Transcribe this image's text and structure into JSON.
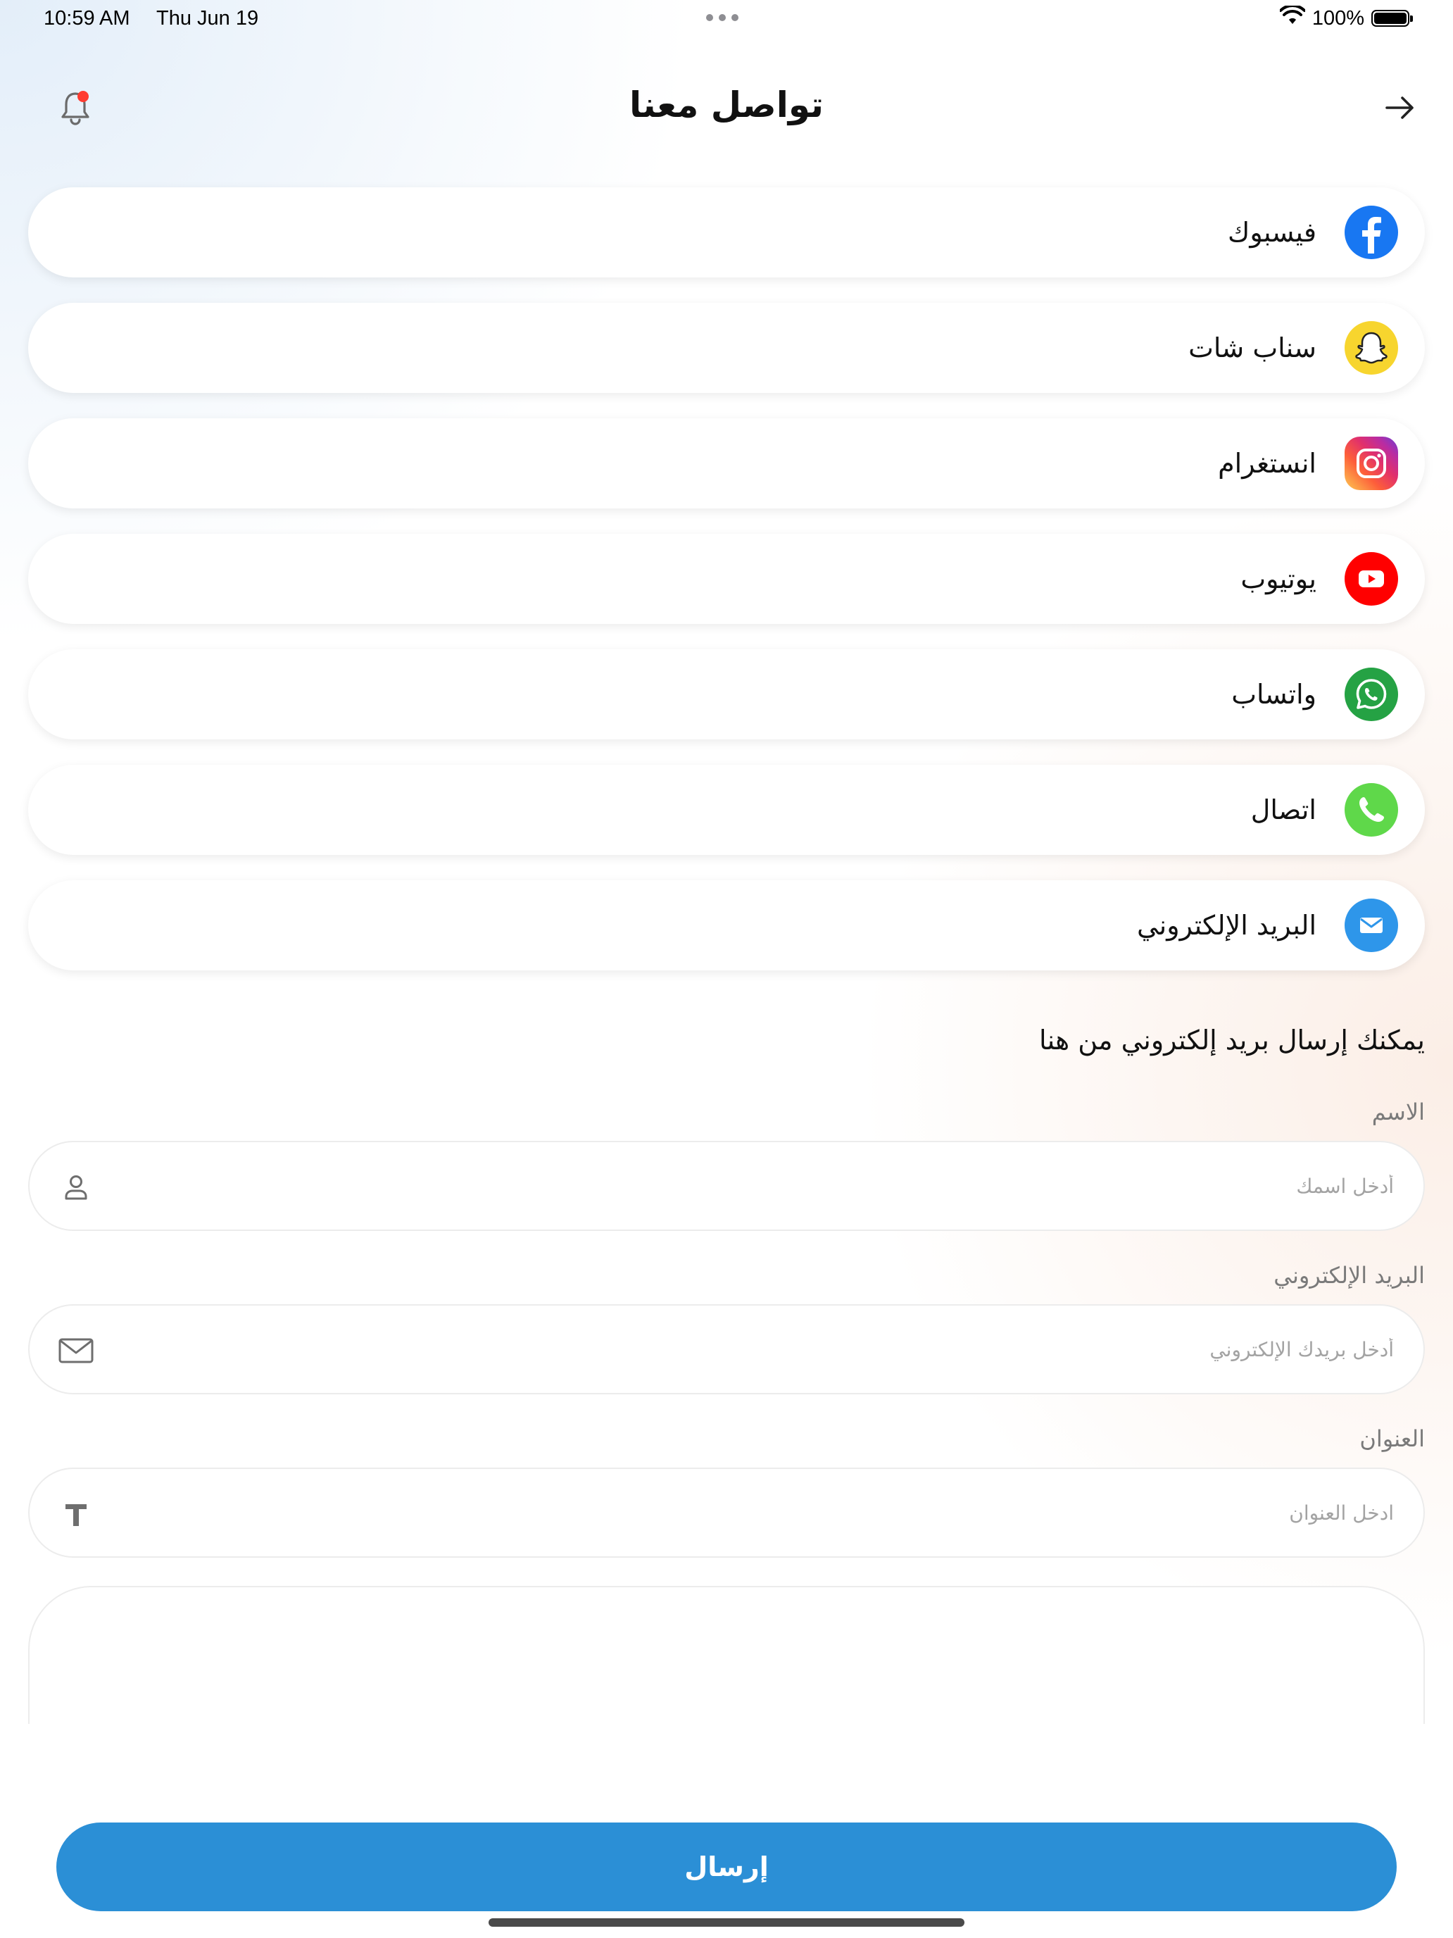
{
  "status_bar": {
    "time": "10:59 AM",
    "date": "Thu Jun 19",
    "battery": "100%"
  },
  "header": {
    "title": "تواصل معنا",
    "back_icon": "arrow-right-icon",
    "notification_icon": "bell-icon"
  },
  "social_links": [
    {
      "label": "فيسبوك",
      "icon": "facebook-icon",
      "color": "#1877f2"
    },
    {
      "label": "سناب شات",
      "icon": "snapchat-icon",
      "color": "#fffc00"
    },
    {
      "label": "انستغرام",
      "icon": "instagram-icon",
      "color": "#e1306c"
    },
    {
      "label": "يوتيوب",
      "icon": "youtube-icon",
      "color": "#ff0000"
    },
    {
      "label": "واتساب",
      "icon": "whatsapp-icon",
      "color": "#25a244"
    },
    {
      "label": "اتصال",
      "icon": "phone-icon",
      "color": "#5fd84a"
    },
    {
      "label": "البريد الإلكتروني",
      "icon": "mail-icon",
      "color": "#2e96ea"
    }
  ],
  "form": {
    "heading": "يمكنك إرسال بريد إلكتروني من هنا",
    "name": {
      "label": "الاسم",
      "placeholder": "أدخل اسمك",
      "value": ""
    },
    "email": {
      "label": "البريد الإلكتروني",
      "placeholder": "أدخل بريدك الإلكتروني",
      "value": ""
    },
    "subject": {
      "label": "العنوان",
      "placeholder": "ادخل العنوان",
      "value": ""
    },
    "message": {
      "placeholder": "",
      "value": ""
    },
    "submit_label": "إرسال"
  },
  "colors": {
    "primary": "#2b8fd6",
    "notification_dot": "#ff3b30"
  }
}
